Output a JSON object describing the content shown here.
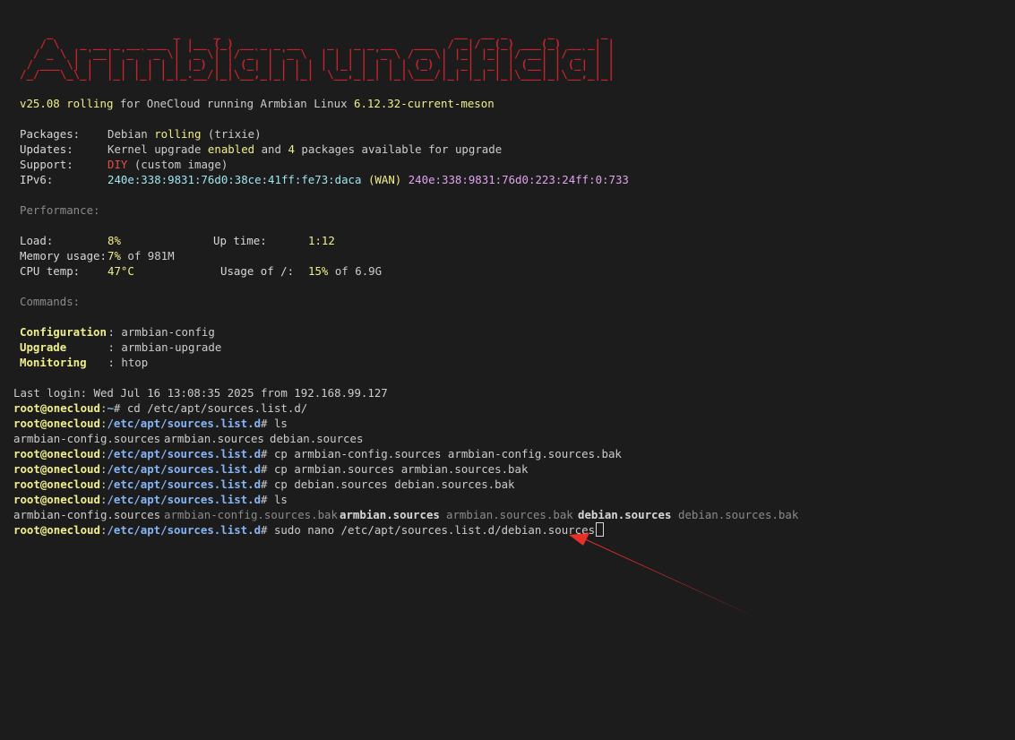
{
  "banner": "    _                  _     _                                   __  __ _      _       _ \n   / \\   _ __ _ __ ___ | |__ (_) __ _ _ __    _   _ _ __   ___  / _|/ _(_) ___(_) __ _| |\n  / _ \\ | '__| '_ ` _ \\| '_ \\| |/ _` | '_ \\  | | | | '_ \\ / _ \\| |_| |_| |/ __| |/ _` | |\n / ___ \\| |  | | | | | | |_) | | (_| | | | | | |_| | | | | (_) |  _|  _| | (__| | (_| | |\n/_/   \\_\\_|  |_| |_| |_|_.__/|_|\\__,_|_| |_|  \\__,_|_| |_|\\___/|_| |_| |_|\\___|_|\\__,_|_|",
  "motd": {
    "version": "v25.08 rolling",
    "for_text": " for OneCloud running Armbian Linux ",
    "kernel": "6.12.32-current-meson",
    "packages_label": "Packages:",
    "packages_pre": "Debian ",
    "packages_branch": "rolling",
    "packages_post": " (trixie)",
    "updates_label": "Updates:",
    "updates_pre": "Kernel upgrade ",
    "updates_enabled": "enabled",
    "updates_mid": " and ",
    "updates_count": "4",
    "updates_post": " packages available for upgrade",
    "support_label": "Support:",
    "support_value": "DIY",
    "support_post": " (custom image)",
    "ipv6_label": "IPv6:",
    "ipv6_wan": "240e:338:9831:76d0:38ce:41ff:fe73:daca",
    "ipv6_wan_tag": " (WAN) ",
    "ipv6_other": "240e:338:9831:76d0:223:24ff:0:733",
    "performance_heading": "Performance:",
    "load_label": "Load:",
    "load_value": "8%",
    "uptime_label": "Up time:",
    "uptime_value": "1:12",
    "memory_label": "Memory usage:",
    "memory_value": "7%",
    "memory_post": " of 981M",
    "cputemp_label": "CPU temp:",
    "cputemp_value": "47°C",
    "usage_label": "Usage of /:",
    "usage_value": "15%",
    "usage_post": " of 6.9G",
    "commands_heading": "Commands:",
    "cmd1_name": "Configuration",
    "cmd1_sep": " : ",
    "cmd1_value": "armbian-config",
    "cmd2_name": "Upgrade",
    "cmd2_value": "armbian-upgrade",
    "cmd3_name": "Monitoring",
    "cmd3_value": "htop"
  },
  "shell": {
    "last_login": "Last login: Wed Jul 16 13:08:35 2025 from 192.168.99.127",
    "user_host": "root@onecloud",
    "colon": ":",
    "home_path": "~",
    "apt_path": "/etc/apt/sources.list.d",
    "prompt_char": "# ",
    "cmd1": "cd /etc/apt/sources.list.d/",
    "cmd2": "ls",
    "ls1_a": "armbian-config.sources",
    "ls1_b": "armbian.sources",
    "ls1_c": "debian.sources",
    "cmd3": "cp armbian-config.sources armbian-config.sources.bak",
    "cmd4": "cp armbian.sources armbian.sources.bak",
    "cmd5": "cp debian.sources debian.sources.bak",
    "cmd6": "ls",
    "ls2_a": "armbian-config.sources",
    "ls2_b": "armbian-config.sources.bak",
    "ls2_c": "armbian.sources",
    "ls2_d": "armbian.sources.bak",
    "ls2_e": "debian.sources",
    "ls2_f": "debian.sources.bak",
    "cmd7": "sudo nano /etc/apt/sources.list.d/debian.sources"
  },
  "colors": {
    "background": "#1c1c1c",
    "banner": "#c4232b",
    "highlight_yellow": "#f0ef8c",
    "path_blue": "#86b4f5",
    "ipv6_cyan": "#9ee6f0",
    "ipv6_magenta": "#e0a4f0",
    "diy_red": "#e84a4a",
    "annotation_arrow": "#e8302a"
  }
}
